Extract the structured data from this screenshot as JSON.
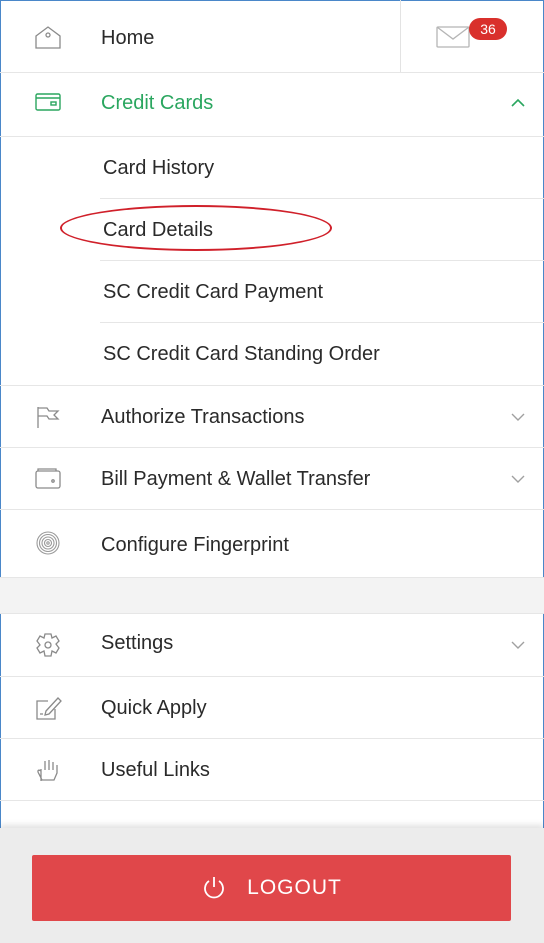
{
  "home": {
    "label": "Home",
    "mail_count": "36"
  },
  "credit_cards": {
    "label": "Credit Cards",
    "accent": "#2aa65f",
    "items": [
      {
        "label": "Card History"
      },
      {
        "label": "Card Details"
      },
      {
        "label": "SC Credit Card Payment"
      },
      {
        "label": "SC Credit Card Standing Order"
      }
    ]
  },
  "menu": [
    {
      "label": "Authorize Transactions",
      "icon": "flag-icon"
    },
    {
      "label": "Bill Payment & Wallet Transfer",
      "icon": "wallet-icon"
    },
    {
      "label": "Configure Fingerprint",
      "icon": "fingerprint-icon"
    }
  ],
  "menu2": [
    {
      "label": "Settings",
      "icon": "gear-icon"
    },
    {
      "label": "Quick Apply",
      "icon": "edit-card-icon"
    },
    {
      "label": "Useful Links",
      "icon": "hand-icon"
    }
  ],
  "logout": {
    "label": "LOGOUT",
    "color": "#e0474a"
  }
}
